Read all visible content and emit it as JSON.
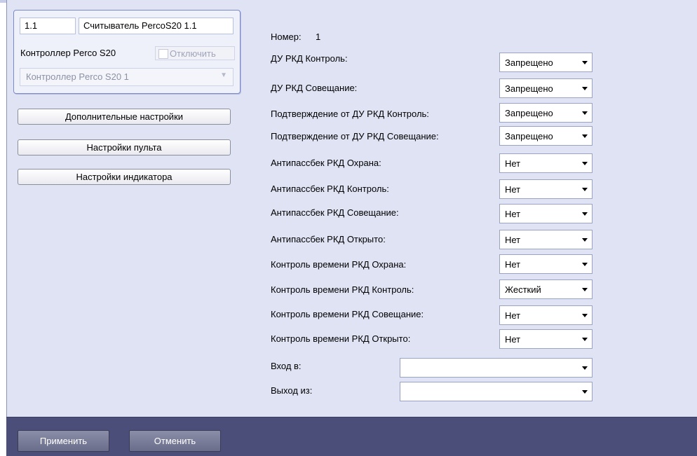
{
  "header": {
    "id_value": "1.1",
    "name_value": "Считыватель PercoS20 1.1",
    "controller_label": "Контроллер Perco S20",
    "disable_label": "Отключить",
    "controller_select": "Контроллер Perco S20 1"
  },
  "buttons": {
    "extra_settings": "Дополнительные настройки",
    "remote_settings": "Настройки пульта",
    "indicator_settings": "Настройки индикатора"
  },
  "number": {
    "label": "Номер:",
    "value": "1"
  },
  "rows": [
    {
      "label": "ДУ РКД Контроль:",
      "value": "Запрещено"
    },
    {
      "label": "ДУ РКД Совещание:",
      "value": "Запрещено"
    },
    {
      "label": "Подтверждение от ДУ РКД Контроль:",
      "value": "Запрещено"
    },
    {
      "label": "Подтверждение от ДУ РКД Совещание:",
      "value": "Запрещено"
    },
    {
      "label": "Антипассбек РКД Охрана:",
      "value": "Нет"
    },
    {
      "label": "Антипассбек РКД Контроль:",
      "value": "Нет"
    },
    {
      "label": "Антипассбек РКД Совещание:",
      "value": "Нет"
    },
    {
      "label": "Антипассбек РКД Открыто:",
      "value": "Нет"
    },
    {
      "label": "Контроль времени РКД Охрана:",
      "value": "Нет"
    },
    {
      "label": "Контроль времени РКД Контроль:",
      "value": "Жесткий"
    },
    {
      "label": "Контроль времени РКД Совещание:",
      "value": "Нет"
    },
    {
      "label": "Контроль времени РКД Открыто:",
      "value": "Нет"
    }
  ],
  "entry": {
    "label": "Вход в:",
    "value": ""
  },
  "exit": {
    "label": "Выход из:",
    "value": ""
  },
  "footer": {
    "apply": "Применить",
    "cancel": "Отменить"
  }
}
